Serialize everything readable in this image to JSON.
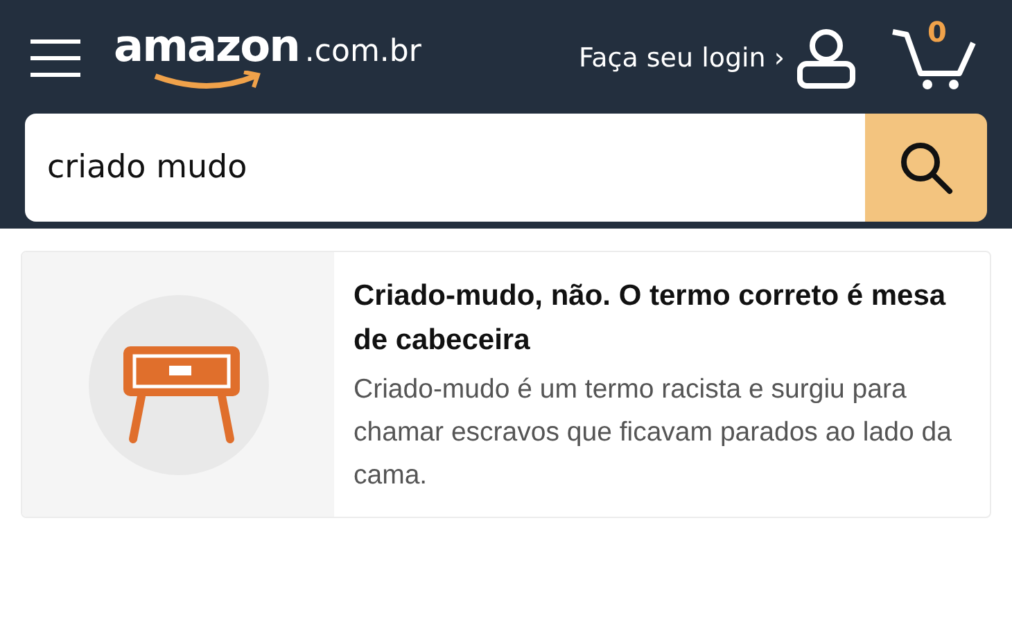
{
  "header": {
    "logo": {
      "name": "amazon",
      "suffix": ".com.br"
    },
    "login": "Faça seu login ›",
    "cart_count": "0"
  },
  "search": {
    "value": "criado mudo"
  },
  "result_card": {
    "title": "Criado-mudo, não. O termo correto é mesa de cabeceira",
    "description": "Criado-mudo é um termo racista e surgiu para chamar escravos que ficavam parados ao lado da cama."
  }
}
